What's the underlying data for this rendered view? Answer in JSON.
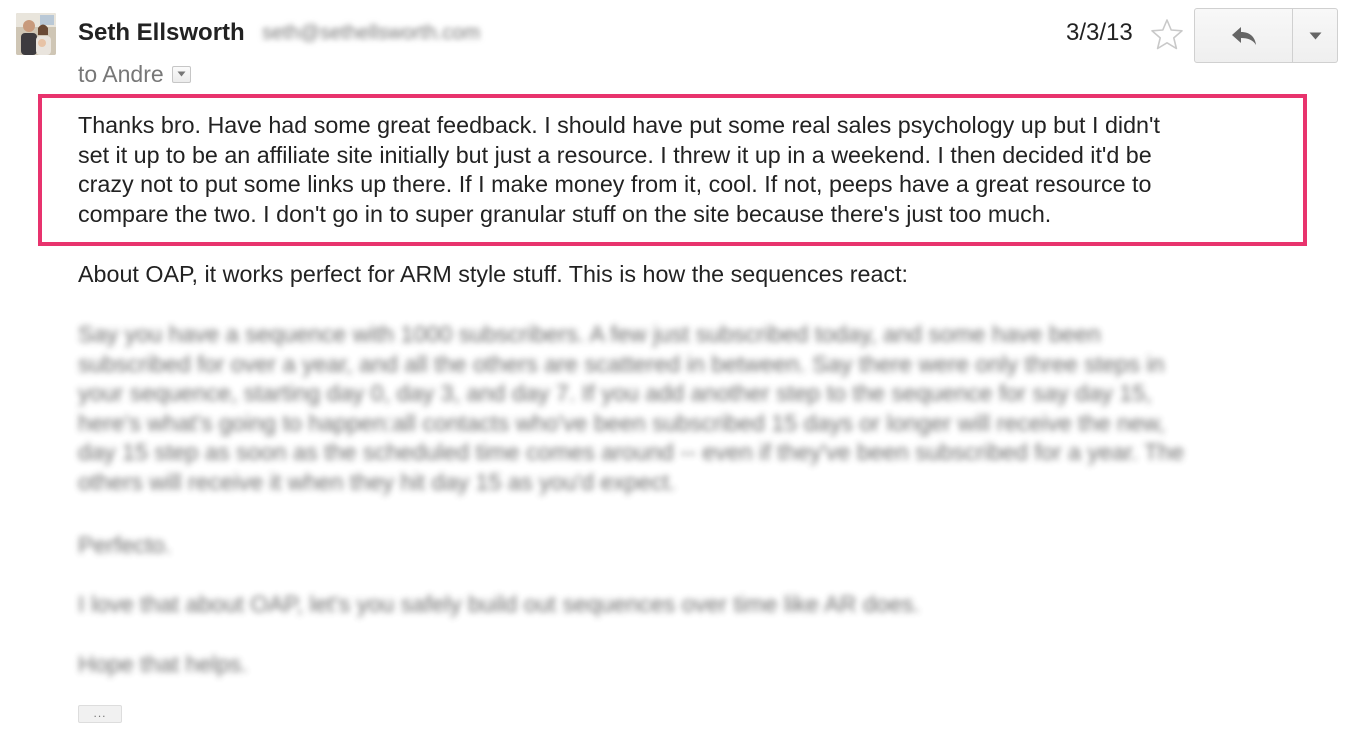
{
  "header": {
    "sender_name": "Seth Ellsworth",
    "sender_email": "seth@sethellsworth.com",
    "recipient": "to Andre",
    "date": "3/3/13",
    "icons": {
      "avatar": "sender-avatar",
      "details": "chevron-down-icon",
      "star": "star-icon",
      "reply": "reply-icon",
      "more": "chevron-down-icon"
    }
  },
  "body": {
    "highlighted_lines": [
      "Thanks bro. Have had some great feedback. I should have put some real sales psychology up but I didn't",
      "set it up to be an affiliate site initially but just a resource. I threw it up in a weekend. I then decided it'd be",
      "crazy not to put some links up there. If I make money from it, cool. If not, peeps have a great resource to",
      "compare the two. I don't go in to super granular stuff on the site because there's just too much."
    ],
    "oap_paragraph": "About OAP, it works perfect for ARM style stuff. This is how the sequences react:",
    "sequence_lines": [
      "Say you have a sequence with 1000 subscribers. A few just subscribed today, and some have been",
      "subscribed for over a year, and all the others are scattered in between. Say there were only three steps in",
      "your sequence, starting day 0, day 3, and day 7. If you add another step to the sequence for say day 15,",
      "here's what's going to happen:all contacts who've been subscribed 15 days or longer will receive the new,",
      "day 15 step as soon as the scheduled time comes around -- even if they've been subscribed for a year. The",
      "others will receive it when they hit day 15 as you'd expect."
    ],
    "perfecto": "Perfecto.",
    "love_line": "I love that about OAP, let's you safely build out sequences over time like AR does.",
    "hope_line": "Hope that helps.",
    "trimmed_label": "..."
  },
  "colors": {
    "highlight_border": "#e8336d",
    "text": "#222222",
    "muted_text": "#777777"
  }
}
